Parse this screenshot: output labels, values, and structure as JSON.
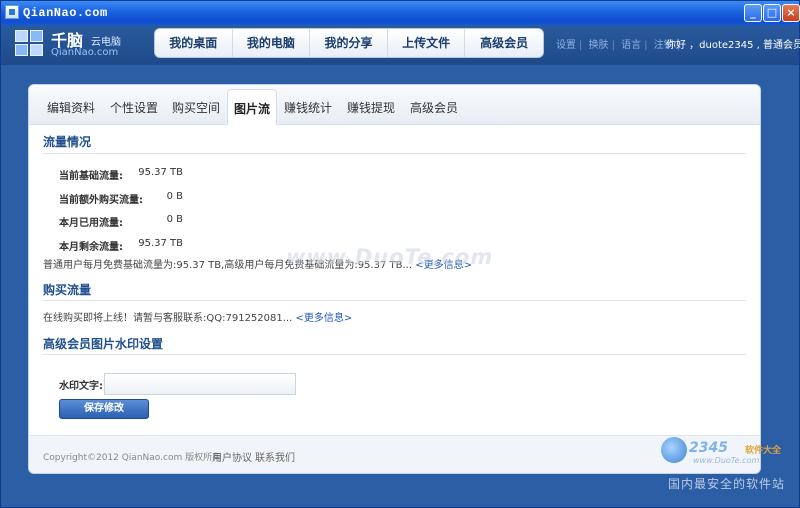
{
  "window": {
    "title": "QianNao.com",
    "minimize_glyph": "_",
    "maximize_glyph": "□",
    "close_glyph": "×"
  },
  "header": {
    "logo_name": "千脑",
    "logo_sub": "云电脑",
    "logo_domain": "QianNao.com",
    "nav": [
      "我的桌面",
      "我的电脑",
      "我的分享",
      "上传文件",
      "高级会员"
    ],
    "toplinks": [
      "设置",
      "换肤",
      "语言",
      "注销"
    ],
    "greeting": "你好 ，duote2345 , 普通会员"
  },
  "tabs": [
    "编辑资料",
    "个性设置",
    "购买空间",
    "图片流",
    "赚钱统计",
    "赚钱提现",
    "高级会员"
  ],
  "active_tab": "图片流",
  "traffic": {
    "title": "流量情况",
    "rows": [
      {
        "label": "当前基础流量:",
        "value": "95.37 TB"
      },
      {
        "label": "当前额外购买流量:",
        "value": "0 B"
      },
      {
        "label": "本月已用流量:",
        "value": "0 B"
      },
      {
        "label": "本月剩余流量:",
        "value": "95.37 TB"
      }
    ],
    "note": "普通用户每月免费基础流量为:95.37 TB,高级用户每月免费基础流量为:95.37 TB...",
    "more": "<更多信息>"
  },
  "buy": {
    "title": "购买流量",
    "note": "在线购买即将上线！请暂与客服联系:QQ:791252081...",
    "more": "<更多信息>"
  },
  "watermark": {
    "title": "高级会员图片水印设置",
    "label": "水印文字:",
    "input_value": "",
    "save_label": "保存修改"
  },
  "footer": {
    "copyright": "Copyright©2012 QianNao.com 版权所有",
    "links": [
      "用户协议",
      "联系我们"
    ]
  },
  "overlays": {
    "center_watermark": "www.DuoTe.com",
    "brand_2345": "2345",
    "brand_2345_suffix": "软件大全",
    "brand_2345_url": "www.DuoTe.com",
    "slogan": "国内最安全的软件站"
  }
}
